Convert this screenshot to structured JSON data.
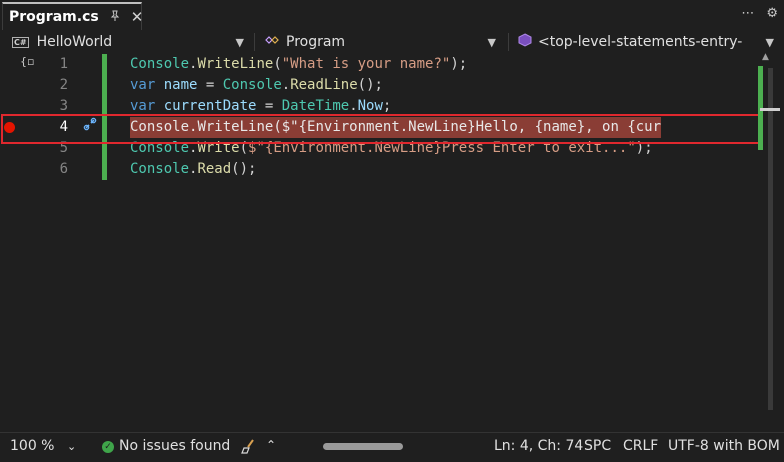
{
  "tab": {
    "title": "Program.cs",
    "pin_icon": "pin-icon",
    "close_glyph": "✕"
  },
  "strip_icons": {
    "more": "⋯",
    "settings": "⚙"
  },
  "nav": {
    "project": "HelloWorld",
    "project_badge": "C#",
    "type": "Program",
    "member": "<top-level-statements-entry-"
  },
  "editor": {
    "lines": [
      {
        "num": "1",
        "tokens": [
          [
            "t-type",
            "Console"
          ],
          [
            "t-punc",
            "."
          ],
          [
            "t-method",
            "WriteLine"
          ],
          [
            "t-punc",
            "("
          ],
          [
            "t-str",
            "\"What is your name?\""
          ],
          [
            "t-punc",
            ");"
          ]
        ]
      },
      {
        "num": "2",
        "tokens": [
          [
            "t-kw",
            "var"
          ],
          [
            "t-punc",
            " "
          ],
          [
            "t-id",
            "name"
          ],
          [
            "t-punc",
            " = "
          ],
          [
            "t-type",
            "Console"
          ],
          [
            "t-punc",
            "."
          ],
          [
            "t-method",
            "ReadLine"
          ],
          [
            "t-punc",
            "();"
          ]
        ]
      },
      {
        "num": "3",
        "tokens": [
          [
            "t-kw",
            "var"
          ],
          [
            "t-punc",
            " "
          ],
          [
            "t-id",
            "currentDate"
          ],
          [
            "t-punc",
            " = "
          ],
          [
            "t-type",
            "DateTime"
          ],
          [
            "t-punc",
            "."
          ],
          [
            "t-id",
            "Now"
          ],
          [
            "t-punc",
            ";"
          ]
        ]
      },
      {
        "num": "4",
        "tokens": [
          [
            "t-type",
            "Console"
          ],
          [
            "t-punc",
            "."
          ],
          [
            "t-method",
            "WriteLine"
          ],
          [
            "t-punc",
            "("
          ],
          [
            "t-str",
            "$\"{Environment.NewLine}Hello, {name}, on {cur"
          ]
        ]
      },
      {
        "num": "5",
        "tokens": [
          [
            "t-type",
            "Console"
          ],
          [
            "t-punc",
            "."
          ],
          [
            "t-method",
            "Write"
          ],
          [
            "t-punc",
            "("
          ],
          [
            "t-str",
            "$\"{Environment.NewLine}Press Enter to exit...\""
          ],
          [
            "t-punc",
            ");"
          ]
        ]
      },
      {
        "num": "6",
        "tokens": [
          [
            "t-type",
            "Console"
          ],
          [
            "t-punc",
            "."
          ],
          [
            "t-method",
            "Read"
          ],
          [
            "t-punc",
            "();"
          ]
        ]
      }
    ],
    "active_line": "4"
  },
  "status": {
    "zoom": "100 %",
    "issues": "No issues found",
    "position": "Ln: 4, Ch: 74",
    "whitespace": "SPC",
    "line_endings": "CRLF",
    "encoding": "UTF-8 with BOM"
  },
  "colors": {
    "breakpoint": "#e51400",
    "highlight": "#8a3d35",
    "changebar": "#4caf50",
    "outline": "#e0282e"
  }
}
